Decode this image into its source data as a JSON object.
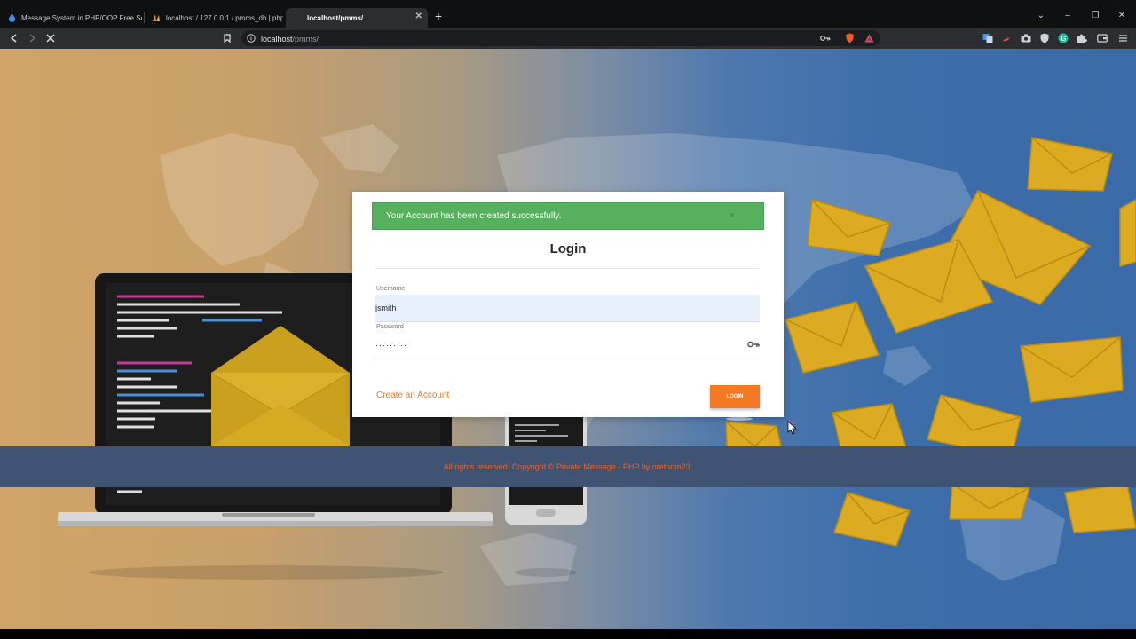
{
  "browser": {
    "tabs": [
      {
        "title": "Message System in PHP/OOP Free So",
        "active": false
      },
      {
        "title": "localhost / 127.0.0.1 / pmms_db | php",
        "active": false
      },
      {
        "title": "localhost/pmms/",
        "active": true
      }
    ],
    "url_host": "localhost",
    "url_path": "/pmms/"
  },
  "alert": {
    "message": "Your Account has been created successfully.",
    "close_label": "×"
  },
  "login": {
    "title": "Login",
    "username_label": "Username",
    "username_value": "jsmith",
    "password_label": "Password",
    "password_value": "·········",
    "create_account_label": "Create an Account",
    "login_button_label": "LOGIN"
  },
  "footer": {
    "text": "All rights reserved. Copyright © Private Message - PHP by oretnom23."
  },
  "colors": {
    "alert_bg": "#56b05e",
    "accent": "#f47922",
    "footer_bg": "#3f5373",
    "footer_text": "#e8622a"
  }
}
